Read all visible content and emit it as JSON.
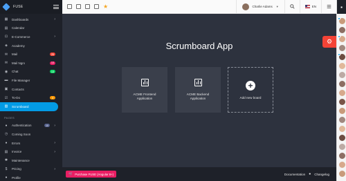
{
  "brand": {
    "name": "FUSE"
  },
  "sidebar": {
    "items": [
      {
        "label": "Dashboards",
        "icon": "dashboard-icon",
        "glyph": "▦",
        "arrow": true
      },
      {
        "label": "Calendar",
        "icon": "calendar-icon",
        "glyph": "▤"
      },
      {
        "label": "E-Commerce",
        "icon": "cart-icon",
        "glyph": "⊡",
        "arrow": true
      },
      {
        "label": "Academy",
        "icon": "school-icon",
        "glyph": "◈"
      },
      {
        "label": "Mail",
        "icon": "mail-icon",
        "glyph": "✉",
        "badge": "25",
        "badge_color": "#f44336"
      },
      {
        "label": "Mail Ngrx",
        "icon": "mail-icon",
        "glyph": "✉",
        "badge": "13",
        "badge_color": "#e91e63"
      },
      {
        "label": "Chat",
        "icon": "chat-icon",
        "glyph": "◉",
        "badge": "13",
        "badge_color": "#09d261"
      },
      {
        "label": "File Manager",
        "icon": "folder-icon",
        "glyph": "▬"
      },
      {
        "label": "Contacts",
        "icon": "contacts-icon",
        "glyph": "▣"
      },
      {
        "label": "To-Do",
        "icon": "check-box-icon",
        "glyph": "☑",
        "badge": "3",
        "badge_color": "#ff9800"
      },
      {
        "label": "Scrumboard",
        "icon": "board-icon",
        "glyph": "▥",
        "active": true
      }
    ],
    "pages_group": "PAGES",
    "pages": [
      {
        "label": "Authentication",
        "icon": "lock-icon",
        "glyph": "●",
        "badge": "10",
        "badge_color": "#525e8a",
        "arrow": true
      },
      {
        "label": "Coming Soon",
        "icon": "alarm-icon",
        "glyph": "◷"
      },
      {
        "label": "Errors",
        "icon": "error-icon",
        "glyph": "●",
        "arrow": true
      },
      {
        "label": "Invoice",
        "icon": "receipt-icon",
        "glyph": "▤",
        "arrow": true
      },
      {
        "label": "Maintenance",
        "icon": "build-icon",
        "glyph": "✱"
      },
      {
        "label": "Pricing",
        "icon": "money-icon",
        "glyph": "$",
        "arrow": true
      },
      {
        "label": "Profile",
        "icon": "person-icon",
        "glyph": "●"
      }
    ]
  },
  "toolbar": {
    "shortcut_icons": [
      "calendar-icon",
      "mail-icon",
      "contacts-icon",
      "todo-icon"
    ],
    "user_name": "Charlie Adams",
    "language": "EN"
  },
  "main": {
    "title": "Scrumboard App",
    "boards": [
      {
        "label": "ACME Frontend Application"
      },
      {
        "label": "ACME Backend Application"
      }
    ],
    "add_board_label": "Add new board"
  },
  "footer": {
    "purchase_label": "Purchase FUSE (Angular 8+)",
    "documentation": "Documentation",
    "changelog": "Changelog"
  },
  "right_panel": {
    "avatar_colors": [
      "#c89b7b",
      "#8d6e63",
      "#d7a98c",
      "#a1887f",
      "#6d4c41",
      "#e0b89a",
      "#bcaaa4",
      "#8d6e63",
      "#d7a98c",
      "#795548",
      "#c89b7b",
      "#a1887f",
      "#e0b89a",
      "#6d4c41",
      "#bcaaa4",
      "#8d6e63",
      "#d7a98c",
      "#c89b7b"
    ],
    "unread_dot_rows": [
      0,
      2,
      4
    ]
  }
}
